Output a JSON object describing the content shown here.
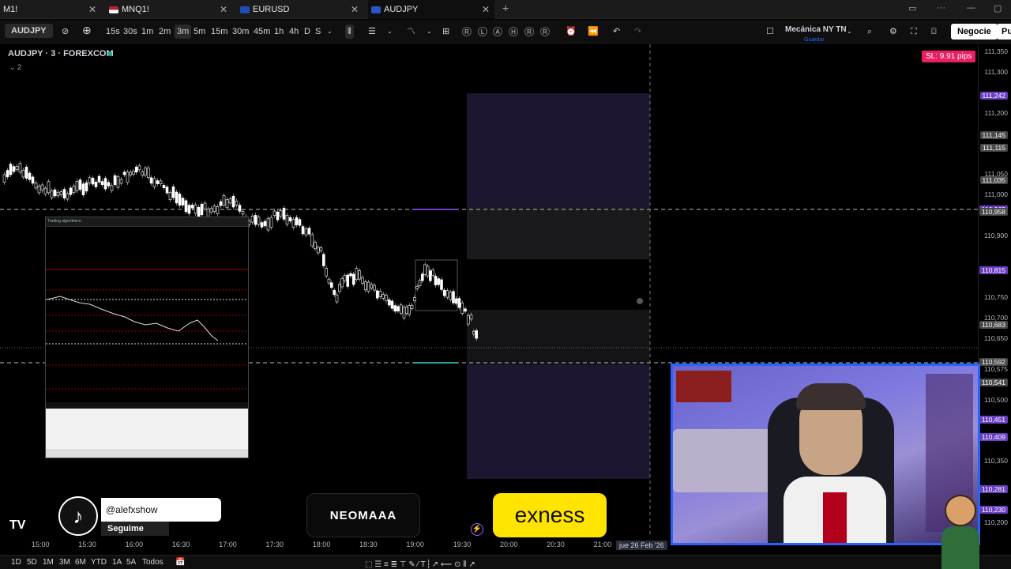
{
  "tabs": [
    {
      "label": "M1!",
      "flag": ""
    },
    {
      "label": "MNQ1!",
      "flag": "us"
    },
    {
      "label": "EURUSD",
      "flag": "eu"
    },
    {
      "label": "AUDJPY",
      "flag": "au"
    }
  ],
  "toolbar": {
    "symbol": "AUDJPY",
    "intervals": [
      "15s",
      "30s",
      "1m",
      "2m",
      "3m",
      "5m",
      "15m",
      "30m",
      "45m",
      "1h",
      "4h",
      "D",
      "S"
    ],
    "selected_interval": "3m",
    "replay_letters": [
      "R",
      "L",
      "A",
      "H",
      "R",
      "R"
    ],
    "preset_name": "Mecánica NY TN",
    "preset_sub": "Guardar",
    "trade_button": "Negocie",
    "publish_button": "Pu"
  },
  "legend": {
    "title": "AUDJPY · 3 · FOREXCOM",
    "indicators_count": "2"
  },
  "sl_badge": "SL: 9.91 pips",
  "price_labels": [
    {
      "text": "111,350",
      "style": "plain"
    },
    {
      "text": "111,300",
      "style": "plain"
    },
    {
      "text": "111,242",
      "style": "purple"
    },
    {
      "text": "111,200",
      "style": "plain"
    },
    {
      "text": "111,145",
      "style": "gray"
    },
    {
      "text": "111,115",
      "style": "gray"
    },
    {
      "text": "111,050",
      "style": "plain"
    },
    {
      "text": "111,035",
      "style": "gray"
    },
    {
      "text": "111,000",
      "style": "plain"
    },
    {
      "text": "110,965",
      "style": "purple"
    },
    {
      "text": "110,958",
      "style": "gray"
    },
    {
      "text": "110,900",
      "style": "plain"
    },
    {
      "text": "110,816",
      "style": "purple"
    },
    {
      "text": "110,815",
      "style": "purple"
    },
    {
      "text": "110,750",
      "style": "plain"
    },
    {
      "text": "110,700",
      "style": "plain"
    },
    {
      "text": "110,683",
      "style": "gray"
    },
    {
      "text": "110,650",
      "style": "plain"
    },
    {
      "text": "110,592",
      "style": "gray"
    },
    {
      "text": "110,575",
      "style": "plain"
    },
    {
      "text": "110,541",
      "style": "gray"
    },
    {
      "text": "110,500",
      "style": "plain"
    },
    {
      "text": "110,451",
      "style": "purple"
    },
    {
      "text": "110,409",
      "style": "purple"
    },
    {
      "text": "110,350",
      "style": "plain"
    },
    {
      "text": "110,281",
      "style": "purple"
    },
    {
      "text": "110,230",
      "style": "purple"
    },
    {
      "text": "110,200",
      "style": "plain"
    }
  ],
  "time_labels": [
    "15:00",
    "15:30",
    "16:00",
    "16:30",
    "17:00",
    "17:30",
    "18:00",
    "18:30",
    "19:00",
    "19:30",
    "20:00",
    "20:30",
    "21:00"
  ],
  "crosshair_date": "jue 26 Feb '26",
  "bottom_ranges": [
    "1D",
    "5D",
    "1M",
    "3M",
    "6M",
    "YTD",
    "1A",
    "5A",
    "Todos"
  ],
  "overlays": {
    "tiktok_handle": "@alefxshow",
    "tiktok_follow": "Seguime",
    "sponsor1": "NEOMAAA",
    "sponsor2": "exness",
    "mt_panel_tab": "Trading algorítmico"
  },
  "colors": {
    "accent": "#2962ff",
    "sl_badge": "#e91e63",
    "purple_zone": "#1c1631",
    "gray_zone": "#1a1a1c",
    "label_purple": "#6a3fc2",
    "label_gray": "#4a4a4a"
  },
  "icons": [
    "add-symbol-icon",
    "interval-bars-icon",
    "indicators-icon",
    "layout-grid-icon",
    "alert-icon",
    "replay-icon",
    "undo-icon",
    "redo-icon",
    "layout-square-icon",
    "search-icon",
    "settings-icon",
    "fullscreen-icon",
    "camera-icon",
    "tradingview-logo-icon"
  ]
}
